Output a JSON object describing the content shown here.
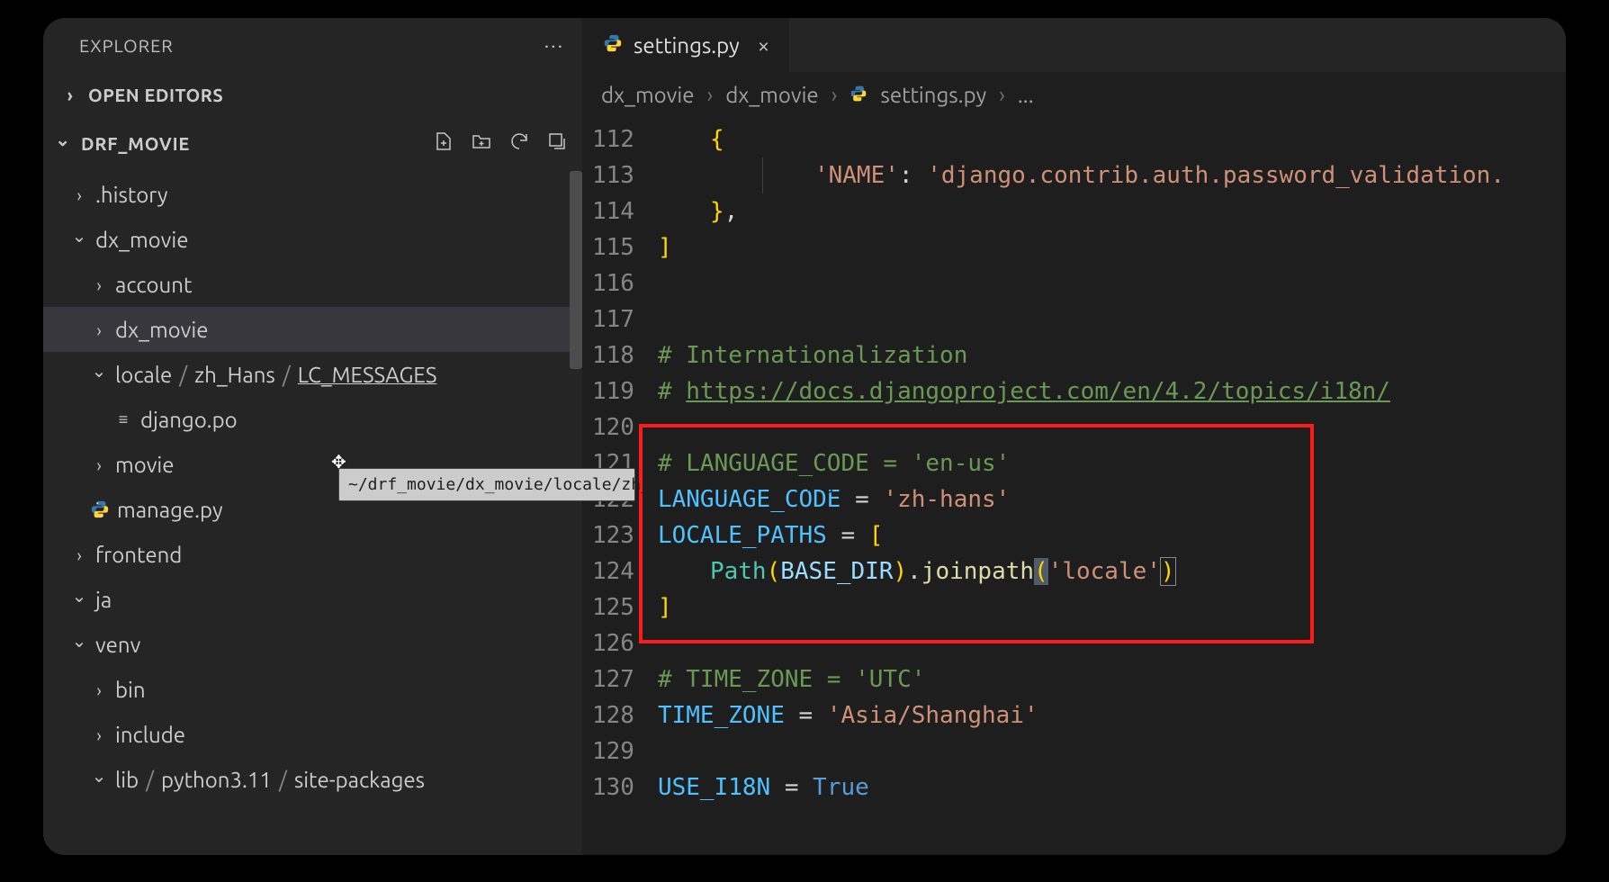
{
  "explorer": {
    "title": "EXPLORER",
    "open_editors": "OPEN EDITORS",
    "workspace": "DRF_MOVIE"
  },
  "tree": {
    "history": ".history",
    "dx_movie": "dx_movie",
    "account": "account",
    "dx_movie_inner": "dx_movie",
    "locale_crumb1": "locale",
    "locale_crumb2": "zh_Hans",
    "locale_crumb3": "LC_MESSAGES",
    "django_po": "django.po",
    "movie": "movie",
    "manage": "manage.py",
    "frontend": "frontend",
    "ja": "ja",
    "venv": "venv",
    "bin": "bin",
    "include": "include",
    "lib_crumb1": "lib",
    "lib_crumb2": "python3.11",
    "lib_crumb3": "site-packages"
  },
  "tooltip": "~/drf_movie/dx_movie/locale/zh_Hans/LC_MESSAGES/django.po",
  "tab": {
    "label": "settings.py"
  },
  "breadcrumbs": {
    "a": "dx_movie",
    "b": "dx_movie",
    "c": "settings.py",
    "d": "..."
  },
  "code_lines": [
    "112",
    "113",
    "114",
    "115",
    "116",
    "117",
    "118",
    "119",
    "120",
    "121",
    "122",
    "123",
    "124",
    "125",
    "126",
    "127",
    "128",
    "129",
    "130"
  ],
  "code": {
    "l112": "{",
    "l113_key": "'NAME'",
    "l113_val": "'django.contrib.auth.password_validation.",
    "l114": "},",
    "l115": "]",
    "l118": "# Internationalization",
    "l119_pre": "# ",
    "l119_url": "https://docs.djangoproject.com/en/4.2/topics/i18n/",
    "l121": "# LANGUAGE_CODE = 'en-us'",
    "l122_var": "LANGUAGE_CODE",
    "l122_val": "'zh-hans'",
    "l123_var": "LOCALE_PATHS",
    "l124_cls": "Path",
    "l124_arg": "BASE_DIR",
    "l124_fn": "joinpath",
    "l124_str": "'locale'",
    "l125": "]",
    "l127": "# TIME_ZONE = 'UTC'",
    "l128_var": "TIME_ZONE",
    "l128_val": "'Asia/Shanghai'",
    "l130_var": "USE_I18N",
    "l130_val": "True"
  }
}
